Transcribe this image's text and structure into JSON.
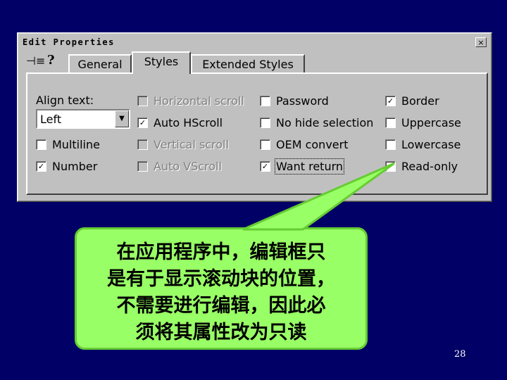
{
  "window": {
    "title": "Edit Properties",
    "close_label": "×"
  },
  "toolbar": {
    "pin_icon": "pushpin-icon",
    "help_icon": "help-icon",
    "pin_glyph": "⊣≡",
    "help_glyph": "?"
  },
  "tabs": [
    {
      "label": "General",
      "active": false
    },
    {
      "label": "Styles",
      "active": true
    },
    {
      "label": "Extended Styles",
      "active": false
    }
  ],
  "align": {
    "label": "Align text:",
    "value": "Left",
    "dropdown_glyph": "▼"
  },
  "checkboxes": [
    {
      "label": "Horizontal scroll",
      "checked": false,
      "disabled": true
    },
    {
      "label": "Password",
      "checked": false,
      "disabled": false
    },
    {
      "label": "Border",
      "checked": true,
      "disabled": false
    },
    {
      "label": "Auto HScroll",
      "checked": true,
      "disabled": false
    },
    {
      "label": "No hide selection",
      "checked": false,
      "disabled": false
    },
    {
      "label": "Uppercase",
      "checked": false,
      "disabled": false
    },
    {
      "label": "Multiline",
      "checked": false,
      "disabled": false
    },
    {
      "label": "Vertical scroll",
      "checked": false,
      "disabled": true
    },
    {
      "label": "OEM convert",
      "checked": false,
      "disabled": false
    },
    {
      "label": "Lowercase",
      "checked": false,
      "disabled": false
    },
    {
      "label": "Number",
      "checked": true,
      "disabled": false
    },
    {
      "label": "Auto VScroll",
      "checked": false,
      "disabled": true
    },
    {
      "label": "Want return",
      "checked": true,
      "disabled": false
    },
    {
      "label": "Read-only",
      "checked": true,
      "disabled": false
    }
  ],
  "check_glyph": "✓",
  "callout": {
    "lines": [
      "在应用程序中，编辑框只",
      "是有于显示滚动块的位置，",
      "不需要进行编辑，因此必",
      "须将其属性改为只读"
    ],
    "fill": "#99ff66",
    "border": "#66cc33"
  },
  "page_number": "28",
  "colors": {
    "background": "#000066",
    "dialog": "#c0c0c0"
  }
}
